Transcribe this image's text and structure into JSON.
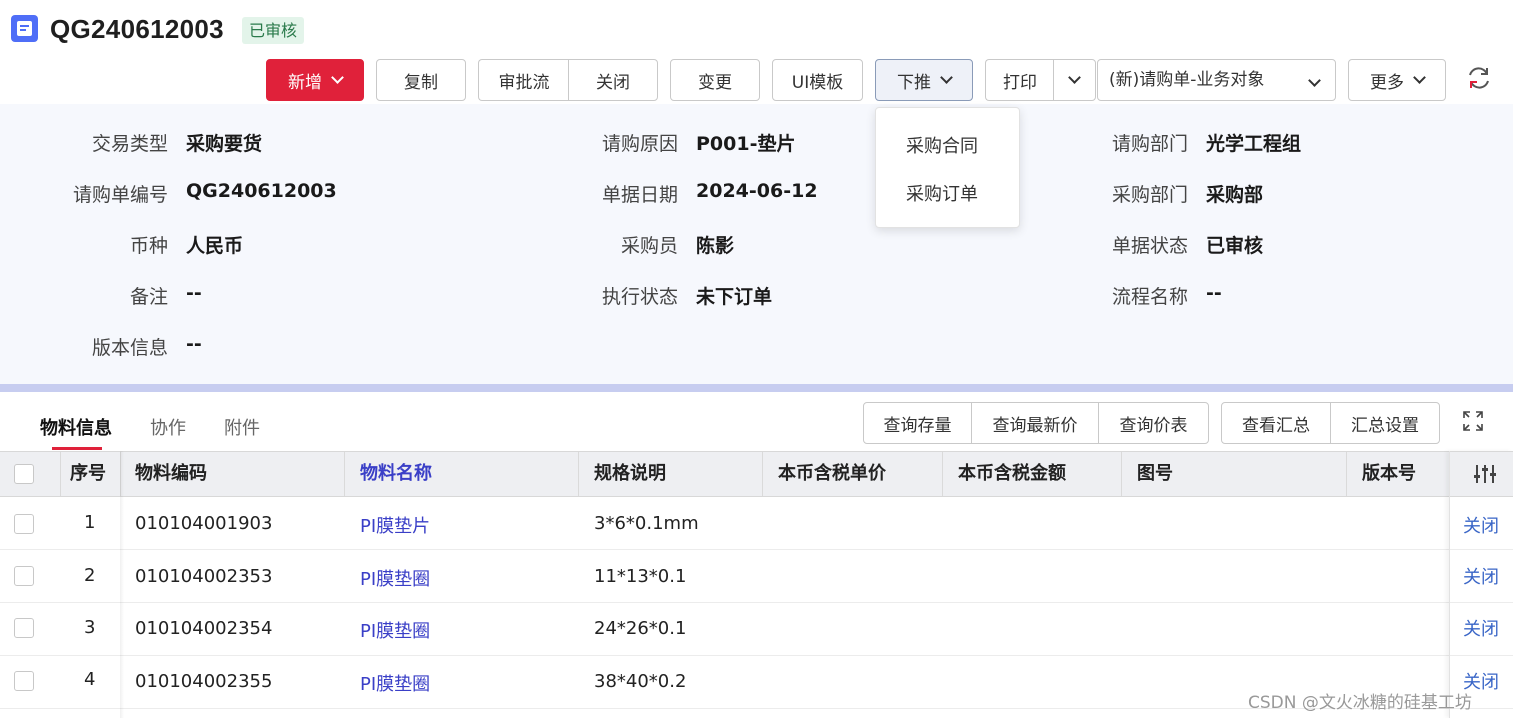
{
  "header": {
    "doc_icon": "document-icon",
    "title": "QG240612003",
    "status": "已审核"
  },
  "toolbar": {
    "add": "新增",
    "copy": "复制",
    "approval_flow": "审批流",
    "close": "关闭",
    "change": "变更",
    "ui_template": "UI模板",
    "push_down": "下推",
    "print": "打印",
    "business_object": "(新)请购单-业务对象",
    "more": "更多",
    "refresh_icon": "refresh-icon"
  },
  "push_down_menu": {
    "items": [
      "采购合同",
      "采购订单"
    ]
  },
  "fields": {
    "trade_type": {
      "label": "交易类型",
      "value": "采购要货"
    },
    "order_no": {
      "label": "请购单编号",
      "value": "QG240612003"
    },
    "currency": {
      "label": "币种",
      "value": "人民币"
    },
    "remark": {
      "label": "备注",
      "value": "--"
    },
    "version_info": {
      "label": "版本信息",
      "value": "--"
    },
    "reason": {
      "label": "请购原因",
      "value": "P001-垫片"
    },
    "doc_date": {
      "label": "单据日期",
      "value": "2024-06-12"
    },
    "buyer": {
      "label": "采购员",
      "value": "陈影"
    },
    "exec_status": {
      "label": "执行状态",
      "value": "未下订单"
    },
    "req_dept": {
      "label": "请购部门",
      "value": "光学工程组"
    },
    "purchase_dept": {
      "label": "采购部门",
      "value": "采购部"
    },
    "doc_status": {
      "label": "单据状态",
      "value": "已审核"
    },
    "flow_name": {
      "label": "流程名称",
      "value": "--"
    }
  },
  "tabs": [
    "物料信息",
    "协作",
    "附件"
  ],
  "table_tools": {
    "query_stock": "查询存量",
    "query_latest_price": "查询最新价",
    "query_price_list": "查询价表",
    "view_summary": "查看汇总",
    "summary_settings": "汇总设置",
    "expand_icon": "fullscreen-icon"
  },
  "table": {
    "columns": [
      "序号",
      "物料编码",
      "物料名称",
      "规格说明",
      "本币含税单价",
      "本币含税金额",
      "图号",
      "版本号"
    ],
    "settings_icon": "column-settings-icon",
    "rows": [
      {
        "seq": "1",
        "code": "010104001903",
        "name": "PI膜垫片",
        "spec": "3*6*0.1mm",
        "action": "关闭"
      },
      {
        "seq": "2",
        "code": "010104002353",
        "name": "PI膜垫圈",
        "spec": "11*13*0.1",
        "action": "关闭"
      },
      {
        "seq": "3",
        "code": "010104002354",
        "name": "PI膜垫圈",
        "spec": "24*26*0.1",
        "action": "关闭"
      },
      {
        "seq": "4",
        "code": "010104002355",
        "name": "PI膜垫圈",
        "spec": "38*40*0.2",
        "action": "关闭"
      }
    ]
  },
  "watermark": "CSDN @文火冰糖的硅基工坊",
  "colors": {
    "primary_red": "#e0213a",
    "link_blue": "#3a3fc7",
    "panel_bg": "#f6f8fd",
    "status_green_bg": "#e3f4ea"
  }
}
